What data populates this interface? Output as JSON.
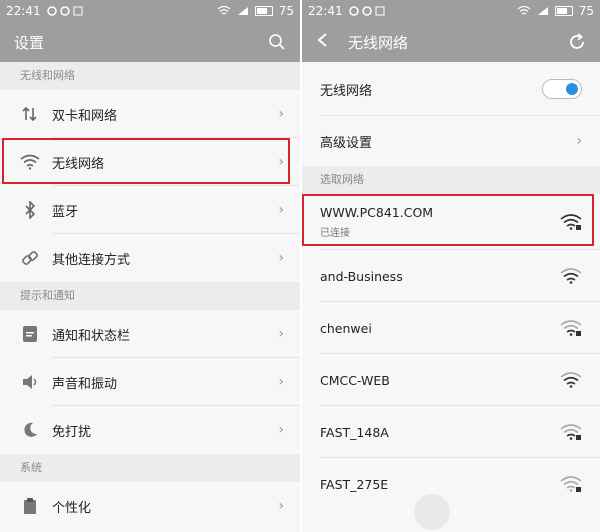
{
  "status": {
    "time": "22:41",
    "battery": "75"
  },
  "left": {
    "title": "设置",
    "sections": [
      {
        "header": "无线和网络",
        "items": [
          {
            "label": "双卡和网络",
            "icon": "sim-icon"
          },
          {
            "label": "无线网络",
            "icon": "wifi-icon"
          },
          {
            "label": "蓝牙",
            "icon": "bluetooth-icon"
          },
          {
            "label": "其他连接方式",
            "icon": "link-icon"
          }
        ]
      },
      {
        "header": "提示和通知",
        "items": [
          {
            "label": "通知和状态栏",
            "icon": "notification-icon"
          },
          {
            "label": "声音和振动",
            "icon": "sound-icon"
          },
          {
            "label": "免打扰",
            "icon": "moon-icon"
          }
        ]
      },
      {
        "header": "系统",
        "items": [
          {
            "label": "个性化",
            "icon": "personalize-icon"
          }
        ]
      }
    ]
  },
  "right": {
    "title": "无线网络",
    "wifi_toggle_label": "无线网络",
    "wifi_on": true,
    "advanced_label": "高级设置",
    "choose_header": "选取网络",
    "networks": [
      {
        "name": "WWW.PC841.COM",
        "status": "已连接",
        "locked": true
      },
      {
        "name": "and-Business",
        "locked": false
      },
      {
        "name": "chenwei",
        "locked": true
      },
      {
        "name": "CMCC-WEB",
        "locked": false
      },
      {
        "name": "FAST_148A",
        "locked": true
      },
      {
        "name": "FAST_275E",
        "locked": true
      }
    ]
  },
  "colors": {
    "accent": "#2b8fe0",
    "highlight": "#d9232a",
    "bar": "#9e9e9e"
  }
}
